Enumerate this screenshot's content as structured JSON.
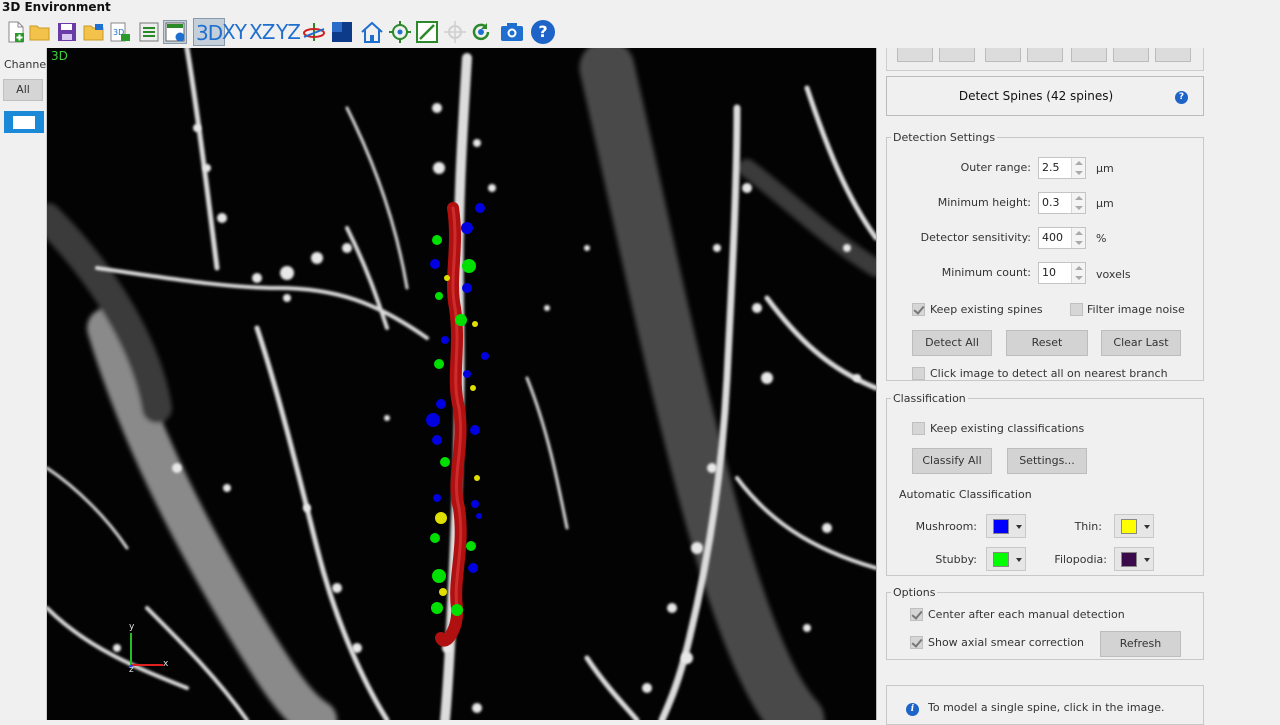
{
  "window": {
    "title": "3D Environment"
  },
  "toolbar": {
    "view_3d": "3D",
    "view_xy": "XY",
    "view_xz": "XZ",
    "view_yz": "YZ",
    "help": "?"
  },
  "left_panel": {
    "channels_label": "Channels",
    "all_button": "All"
  },
  "viewport": {
    "mode_label": "3D",
    "axis_y": "y",
    "axis_x": "x",
    "axis_z": "z"
  },
  "detect_spines": {
    "title": "Detect Spines (42 spines)",
    "help": "?"
  },
  "detection_settings": {
    "legend": "Detection Settings",
    "outer_range_label": "Outer range:",
    "outer_range_value": "2.5",
    "outer_range_unit": "µm",
    "min_height_label": "Minimum height:",
    "min_height_value": "0.3",
    "min_height_unit": "µm",
    "sensitivity_label": "Detector sensitivity:",
    "sensitivity_value": "400",
    "sensitivity_unit": "%",
    "min_count_label": "Minimum count:",
    "min_count_value": "10",
    "min_count_unit": "voxels",
    "keep_existing_spines": "Keep existing spines",
    "filter_noise": "Filter image noise",
    "detect_all": "Detect All",
    "reset": "Reset",
    "clear_last": "Clear Last",
    "click_image": "Click image to detect all on nearest branch"
  },
  "classification": {
    "legend": "Classification",
    "keep_existing": "Keep existing classifications",
    "classify_all": "Classify All",
    "settings": "Settings...",
    "auto_label": "Automatic Classification",
    "mushroom": "Mushroom:",
    "thin": "Thin:",
    "stubby": "Stubby:",
    "filopodia": "Filopodia:",
    "colors": {
      "mushroom": "#0000ff",
      "thin": "#ffff00",
      "stubby": "#00ff00",
      "filopodia": "#3a0a4a"
    }
  },
  "options": {
    "legend": "Options",
    "center_after": "Center after each manual detection",
    "axial_smear": "Show axial smear correction",
    "refresh": "Refresh"
  },
  "info": {
    "text": "To model a single spine, click in the image."
  },
  "colors": {
    "dendrite": "#b01010",
    "accent": "#1e6fd0"
  }
}
